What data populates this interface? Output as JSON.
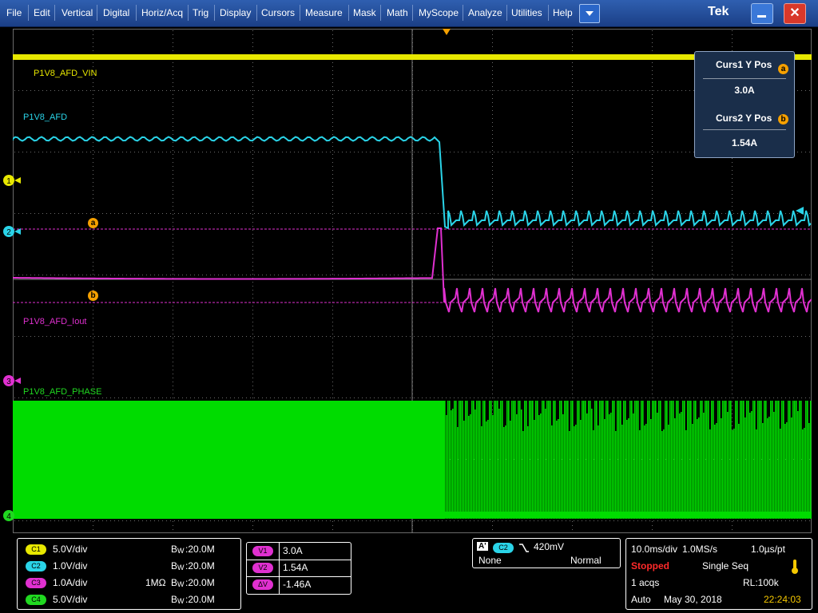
{
  "menu": [
    "File",
    "Edit",
    "Vertical",
    "Digital",
    "Horiz/Acq",
    "Trig",
    "Display",
    "Cursors",
    "Measure",
    "Mask",
    "Math",
    "MyScope",
    "Analyze",
    "Utilities",
    "Help"
  ],
  "brand": "Tek",
  "dropdown_icon": "chevron-down-icon",
  "waveform_labels": {
    "ch1": "P1V8_AFD_VIN",
    "ch2": "P1V8_AFD",
    "ch3": "P1V8_AFD_Iout",
    "ch4": "P1V8_AFD_PHASE"
  },
  "channel_markers": [
    "1",
    "2",
    "3",
    "4"
  ],
  "cursor_markers": {
    "a": "a",
    "b": "b"
  },
  "cursor_readout": {
    "curs1_label": "Curs1 Y Pos",
    "curs1_badge": "a",
    "curs1_value": "3.0A",
    "curs2_label": "Curs2 Y Pos",
    "curs2_badge": "b",
    "curs2_value": "1.54A"
  },
  "channels": [
    {
      "badge": "C1",
      "scale": "5.0V/div",
      "imp": "",
      "bw": "20.0M",
      "color": "#e8e800"
    },
    {
      "badge": "C2",
      "scale": "1.0V/div",
      "imp": "",
      "bw": "20.0M",
      "color": "#2ad4e8"
    },
    {
      "badge": "C3",
      "scale": "1.0A/div",
      "imp": "1MΩ",
      "bw": "20.0M",
      "color": "#e030d0"
    },
    {
      "badge": "C4",
      "scale": "5.0V/div",
      "imp": "",
      "bw": "20.0M",
      "color": "#20d820"
    }
  ],
  "bw_prefix": "B",
  "bw_sub": "W",
  "cursors": [
    {
      "badge": "V1",
      "value": "3.0A"
    },
    {
      "badge": "V2",
      "value": "1.54A"
    },
    {
      "badge": "ΔV",
      "value": "-1.46A"
    }
  ],
  "trigger": {
    "source_a": "A'",
    "source_ch": "C2",
    "slope_icon": "falling-edge-icon",
    "level": "420mV",
    "coupling": "None",
    "mode": "Normal"
  },
  "acquisition": {
    "timebase": "10.0ms/div",
    "sample_rate": "1.0MS/s",
    "resolution": "1.0µs/pt",
    "status": "Stopped",
    "seq": "Single Seq",
    "acqs": "1 acqs",
    "record_length": "RL:100k",
    "trigger_mode": "Auto",
    "date": "May 30, 2018",
    "time": "22:24:03"
  },
  "colors": {
    "ch1": "#e8e800",
    "ch2": "#2ad4e8",
    "ch3": "#e030d0",
    "ch4": "#20d820",
    "cursor": "#f5a000",
    "stopped": "#ff2a2a"
  }
}
